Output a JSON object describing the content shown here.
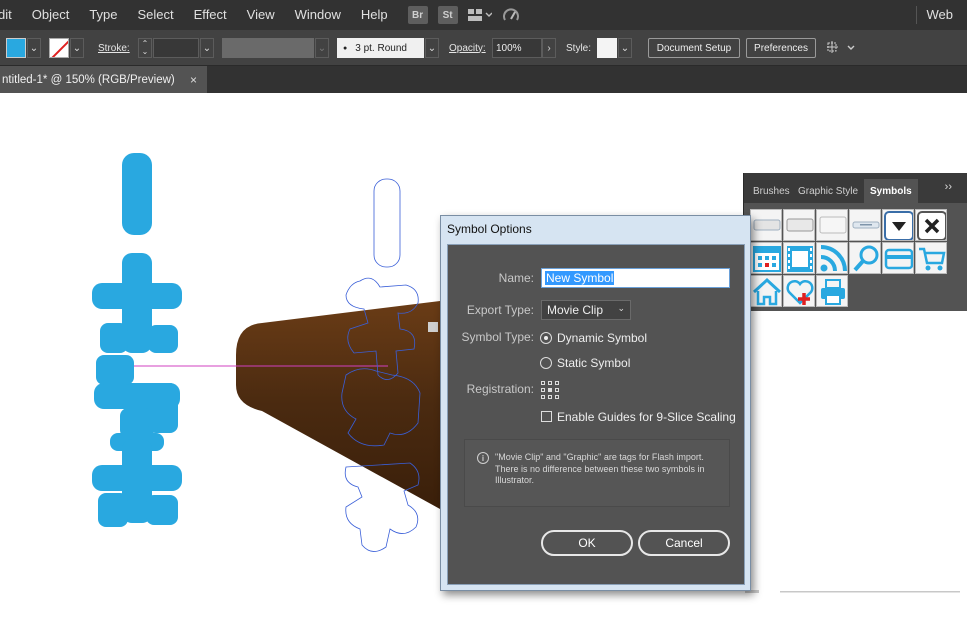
{
  "menubar": {
    "items": [
      "dit",
      "Object",
      "Type",
      "Select",
      "Effect",
      "View",
      "Window",
      "Help"
    ],
    "bridge_label": "Br",
    "stock_label": "St",
    "workspace": "Web"
  },
  "control": {
    "stroke_label": "Stroke:",
    "brush_label": "3 pt. Round",
    "opacity_label": "Opacity:",
    "opacity_value": "100%",
    "style_label": "Style:",
    "document_setup": "Document Setup",
    "preferences": "Preferences",
    "fill_color": "#29a8e0"
  },
  "tab": {
    "title": "ntitled-1* @ 150% (RGB/Preview)",
    "close": "×"
  },
  "panel": {
    "tabs": [
      "Brushes",
      "Graphic Style",
      "Symbols"
    ],
    "active_tab": "Symbols",
    "menu": "››",
    "icons": [
      "button-flat-icon",
      "button-raised-icon",
      "button-light-icon",
      "button-slim-icon",
      "dropdown-arrow-icon",
      "close-x-icon",
      "calendar-icon",
      "film-strip-icon",
      "rss-icon",
      "magnifier-icon",
      "credit-card-icon",
      "shopping-cart-icon",
      "home-icon",
      "heart-plus-icon",
      "printer-icon"
    ]
  },
  "dialog": {
    "title": "Symbol Options",
    "name_label": "Name:",
    "name_value": "New Symbol",
    "export_type_label": "Export Type:",
    "export_type_value": "Movie Clip",
    "symbol_type_label": "Symbol Type:",
    "dynamic_label": "Dynamic Symbol",
    "static_label": "Static Symbol",
    "symbol_type_selected": "Dynamic Symbol",
    "registration_label": "Registration:",
    "guides_label": "Enable Guides for 9-Slice Scaling",
    "guides_checked": false,
    "info_text": "\"Movie Clip\" and \"Graphic\" are tags for Flash import. There is no difference between these two symbols in Illustrator.",
    "ok": "OK",
    "cancel": "Cancel"
  },
  "canvas": {
    "accent_color": "#29a8e0",
    "bar_color": "#4a2a10",
    "guide_color": "#d040c0"
  }
}
